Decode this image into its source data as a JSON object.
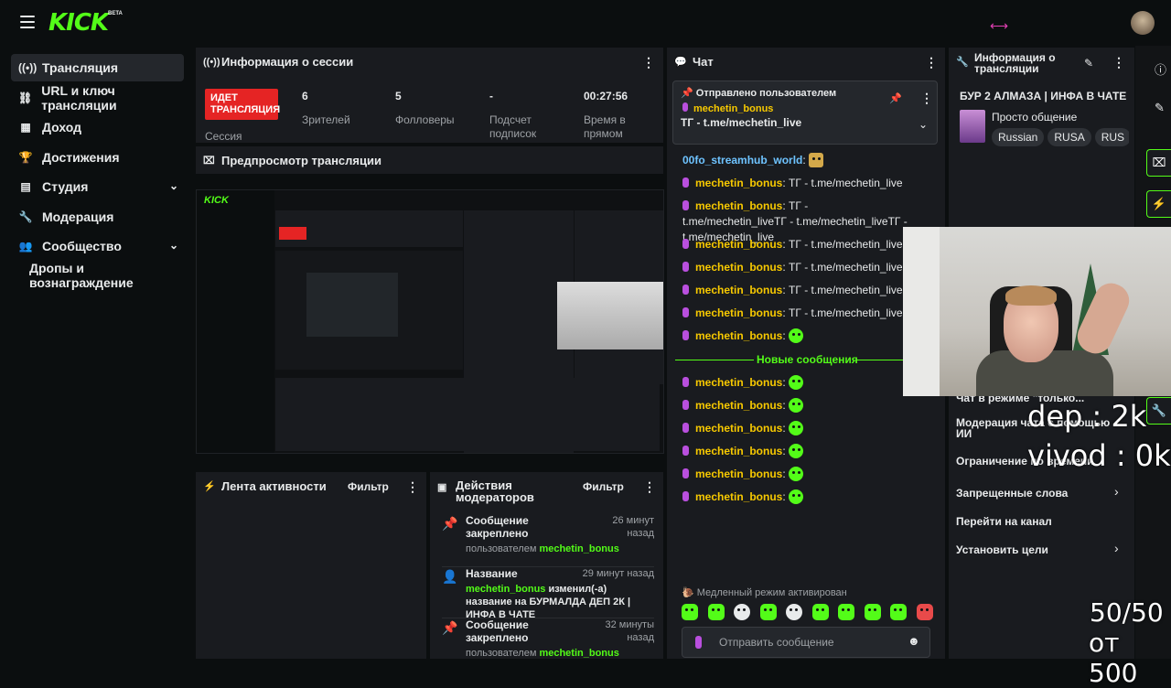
{
  "topbar": {
    "logo": "KICK",
    "beta": "BETA",
    "arrow": "⟷"
  },
  "sidebar": {
    "items": [
      {
        "label": "Трансляция",
        "icon": "broadcast-icon"
      },
      {
        "label": "URL и ключ трансляции",
        "icon": "link-icon"
      },
      {
        "label": "Доход",
        "icon": "chart-icon"
      },
      {
        "label": "Достижения",
        "icon": "trophy-icon"
      },
      {
        "label": "Студия",
        "icon": "studio-icon"
      },
      {
        "label": "Модерация",
        "icon": "wrench-icon"
      },
      {
        "label": "Сообщество",
        "icon": "people-icon"
      },
      {
        "label": "Дропы и вознаграждение",
        "icon": ""
      }
    ]
  },
  "session": {
    "title": "Информация о сессии",
    "live_label": "ИДЕТ ТРАНСЛЯЦИЯ",
    "session_label": "Сессия",
    "stats": [
      {
        "value": "6",
        "label": "Зрителей"
      },
      {
        "value": "5",
        "label": "Фолловеры"
      },
      {
        "value": "-",
        "label": "Подсчет подписок"
      },
      {
        "value": "00:27:56",
        "label": "Время в прямом"
      }
    ]
  },
  "preview": {
    "title": "Предпросмотр трансляции"
  },
  "activity": {
    "title": "Лента активности",
    "filter": "Фильтр"
  },
  "mod_actions": {
    "title": "Действия модераторов",
    "filter": "Фильтр",
    "entries": [
      {
        "title": "Сообщение закреплено",
        "time": "26 минут назад",
        "sub_prefix": "пользователем ",
        "user": "mechetin_bonus",
        "sub_suffix": ""
      },
      {
        "title": "Название",
        "time": "29 минут назад",
        "sub_prefix": "",
        "user": "mechetin_bonus",
        "sub_suffix": " изменил(-а) название на БУРМАЛДА ДЕП 2К | ИНФА В ЧАТЕ"
      },
      {
        "title": "Сообщение закреплено",
        "time": "32 минуты назад",
        "sub_prefix": "пользователем ",
        "user": "mechetin_bonus",
        "sub_suffix": ""
      }
    ]
  },
  "chat": {
    "title": "Чат",
    "pinned_header": "Отправлено пользователем",
    "pinned_user": "mechetin_bonus",
    "pinned_text": "ТГ - t.me/mechetin_live",
    "messages": [
      {
        "user": "00fo_streamhub_world",
        "text": ":",
        "badge": false,
        "emote": true,
        "style": "blue"
      },
      {
        "user": "mechetin_bonus",
        "text": ": ТГ - t.me/mechetin_live",
        "badge": true,
        "emote": false
      },
      {
        "user": "mechetin_bonus",
        "text": ": ТГ - t.me/mechetin_liveТГ - t.me/mechetin_liveТГ - t.me/mechetin_live",
        "badge": true,
        "emote": false
      },
      {
        "user": "mechetin_bonus",
        "text": ": ТГ - t.me/mechetin_live",
        "badge": true,
        "emote": false
      },
      {
        "user": "mechetin_bonus",
        "text": ": ТГ - t.me/mechetin_live",
        "badge": true,
        "emote": false
      },
      {
        "user": "mechetin_bonus",
        "text": ": ТГ - t.me/mechetin_live",
        "badge": true,
        "emote": false
      },
      {
        "user": "mechetin_bonus",
        "text": ": ТГ - t.me/mechetin_live",
        "badge": true,
        "emote": false
      },
      {
        "user": "mechetin_bonus",
        "text": ":",
        "badge": true,
        "emote": true
      }
    ],
    "new_messages_label": "Новые сообщения",
    "new_messages": [
      {
        "user": "mechetin_bonus",
        "text": ":"
      },
      {
        "user": "mechetin_bonus",
        "text": ":"
      },
      {
        "user": "mechetin_bonus",
        "text": ":"
      },
      {
        "user": "mechetin_bonus",
        "text": ":"
      },
      {
        "user": "mechetin_bonus",
        "text": ":"
      },
      {
        "user": "mechetin_bonus",
        "text": ":"
      }
    ],
    "slow_mode": "Медленный режим активирован",
    "input_placeholder": "Отправить сообщение"
  },
  "stream_info": {
    "title": "Информация о трансляции",
    "stream_title": "БУР 2 АЛМАЗА | ИНФА В ЧАТЕ",
    "category": "Просто общение",
    "tags": [
      "Russian",
      "RUSA",
      "RUS"
    ],
    "rows": [
      {
        "label": "Чат в режиме \"только...",
        "chevron": false
      },
      {
        "label": "Модерация чата с помощью ИИ",
        "chevron": false
      },
      {
        "label": "Ограничение по времени",
        "chevron": false
      },
      {
        "label": "Запрещенные слова",
        "chevron": true
      },
      {
        "label": "Перейти на канал",
        "chevron": false
      },
      {
        "label": "Установить цели",
        "chevron": true
      }
    ]
  },
  "overlay": {
    "dep": "dep : 2k",
    "vivod": "vivod : 0k",
    "counter": "50/50",
    "from": "от 500"
  }
}
